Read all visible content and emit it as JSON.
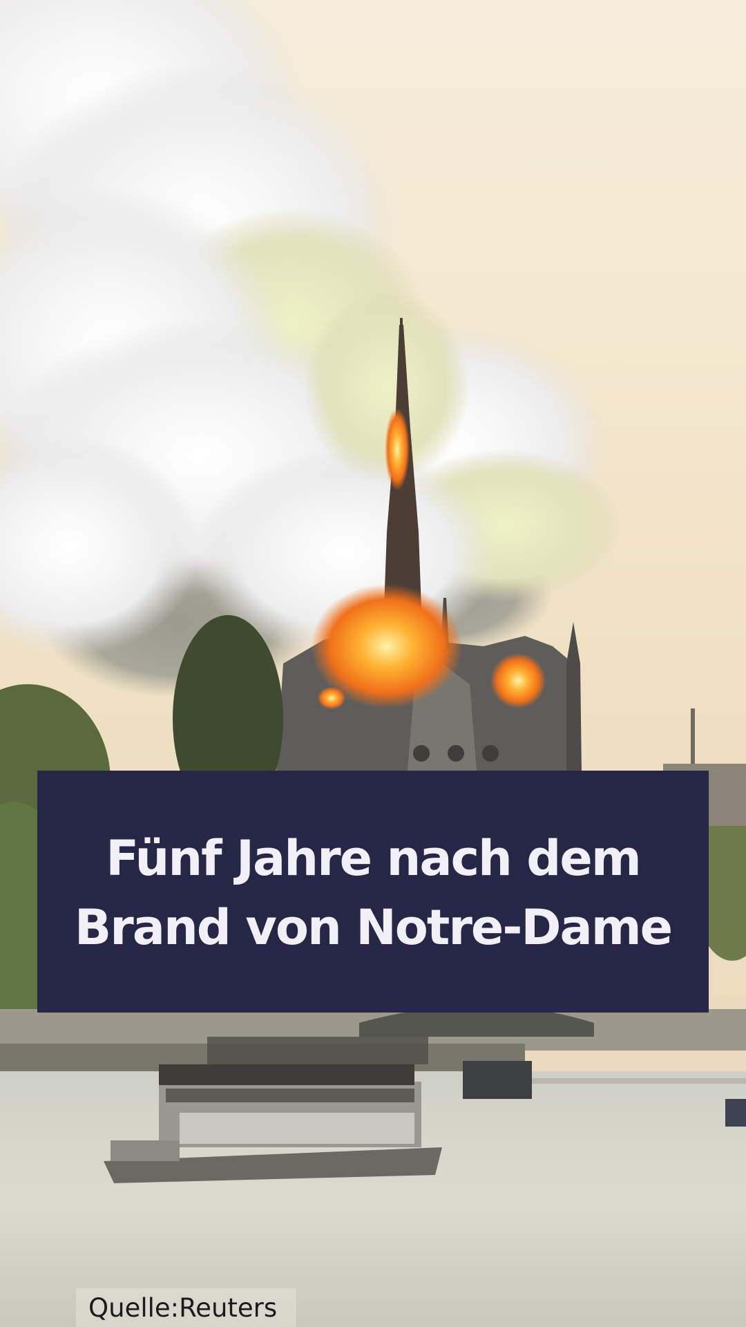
{
  "title": {
    "line1": "Fünf Jahre nach dem",
    "line2": "Brand von Notre-Dame"
  },
  "source": {
    "label": "Quelle:",
    "value": "Reuters"
  }
}
